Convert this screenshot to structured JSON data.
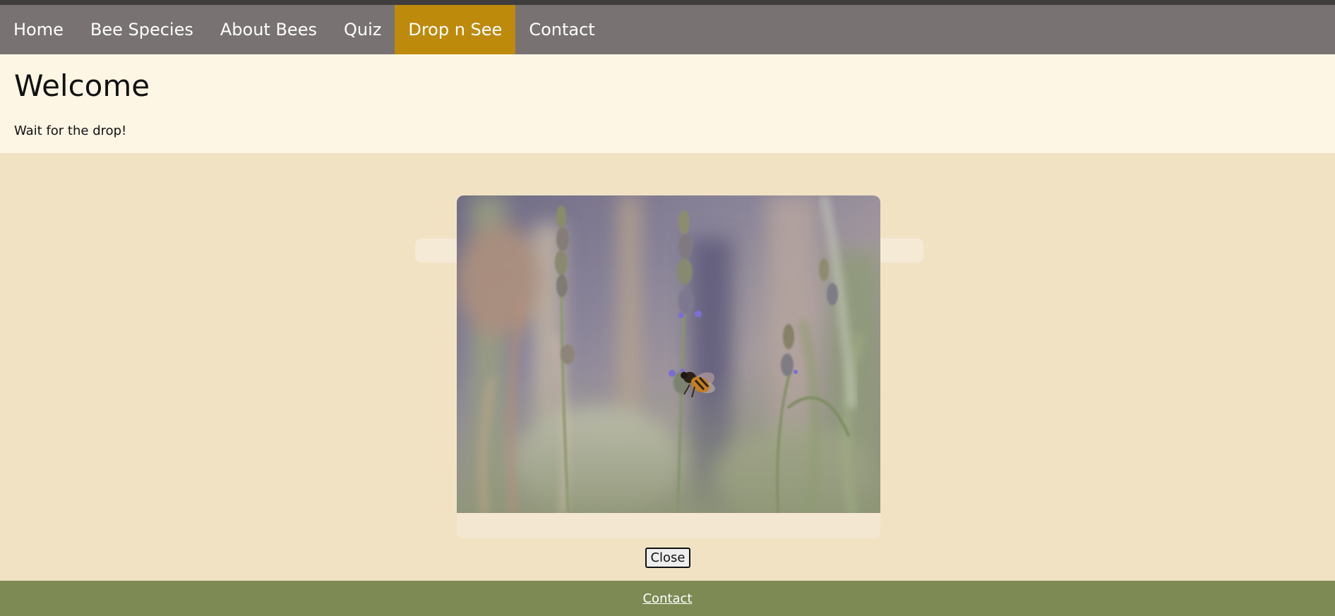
{
  "nav": {
    "items": [
      {
        "label": "Home"
      },
      {
        "label": "Bee Species"
      },
      {
        "label": "About Bees"
      },
      {
        "label": "Quiz"
      },
      {
        "label": "Drop n See"
      },
      {
        "label": "Contact"
      }
    ],
    "active_index": 4
  },
  "welcome": {
    "title": "Welcome",
    "message": "Wait for the drop!"
  },
  "modal": {
    "close_label": "Close"
  },
  "footer": {
    "contact_link": "Contact"
  },
  "colors": {
    "nav_background": "#787273",
    "nav_active": "#bd8a0c",
    "page_background": "#f1e2c4",
    "welcome_background": "#fef6e5",
    "footer_background": "#7d8a54"
  }
}
